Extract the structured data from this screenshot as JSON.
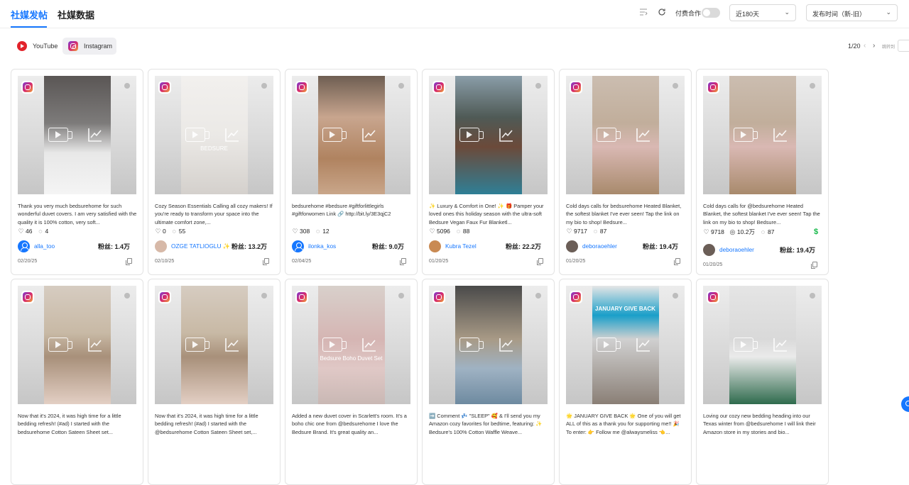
{
  "header": {
    "tabs": [
      {
        "label": "社媒发帖",
        "active": true
      },
      {
        "label": "社媒数据",
        "active": false
      }
    ],
    "paid_label": "付费合作",
    "paid_toggle_on": false,
    "period_select": "近180天",
    "sort_select": "发布时间（新-旧）"
  },
  "platforms": [
    {
      "label": "YouTube",
      "icon": "youtube-icon",
      "active": false
    },
    {
      "label": "Instagram",
      "icon": "instagram-icon",
      "active": true
    }
  ],
  "pagination": {
    "indicator": "1/20",
    "jump_label": "跳转到"
  },
  "accent_color": "#1677ff",
  "cards": [
    {
      "caption": "Thank you very much bedsurehome for such wonderful duvet covers. I am very satisfied with the quality it is 100% cotton, very soft...",
      "likes": "46",
      "comments": "4",
      "author": "alla_too",
      "avatar": "default",
      "fans": "粉丝: 1.4万",
      "date": "02/20/25"
    },
    {
      "caption": "Cozy Season Essentials Calling all cozy makers! If you're ready to transform your space into the ultimate comfort zone,...",
      "likes": "0",
      "comments": "55",
      "author": "OZGE TATLIOGLU ✨",
      "avatar": "photo",
      "fans": "粉丝: 13.2万",
      "date": "02/10/25",
      "overlay": "BEDSURE"
    },
    {
      "caption": "bedsurehome #bedsure #giftforlittlegirls #giftforwomen Link 🔗 http://bit.ly/3E3qjC2",
      "likes": "308",
      "comments": "12",
      "author": "ilonka_kos",
      "avatar": "default",
      "fans": "粉丝: 9.0万",
      "date": "02/04/25"
    },
    {
      "caption": "✨ Luxury & Comfort in One! ✨ 🎁 Pamper your loved ones this holiday season with the ultra-soft Bedsure Vegan Faux Fur Blanketl...",
      "likes": "5096",
      "comments": "88",
      "author": "Kubra Tezel",
      "avatar": "photo",
      "fans": "粉丝: 22.2万",
      "date": "01/20/25"
    },
    {
      "caption": "Cold days calls for bedsurehome Heated Blanket, the softest blanket I've ever seen! Tap the link on my bio to shop! Bedsure...",
      "likes": "9717",
      "comments": "87",
      "author": "deboraoehler",
      "avatar": "photo",
      "fans": "粉丝: 19.4万",
      "date": "01/20/25"
    },
    {
      "caption": "Cold days calls for @bedsurehome Heated Blanket, the softest blanket I've ever seen! Tap the link on my bio to shop! Bedsure...",
      "likes": "9718",
      "views": "10.2万",
      "comments": "87",
      "author": "deboraoehler",
      "avatar": "photo",
      "fans": "粉丝: 19.4万",
      "date": "01/20/25",
      "paid": true
    },
    {
      "caption": "Now that it's 2024, it was high time for a little bedding refresh! (#ad) I started with the bedsurehome Cotton Sateen Sheet set...",
      "likes": "",
      "comments": "",
      "author": "",
      "fans": "",
      "date": ""
    },
    {
      "caption": "Now that it's 2024, it was high time for a little bedding refresh! (#ad) I started with the @bedsurehome Cotton Sateen Sheet set,...",
      "likes": "",
      "comments": "",
      "author": "",
      "fans": "",
      "date": ""
    },
    {
      "caption": "Added a new duvet cover in Scarlett's room. It's a boho chic one from @bedsurehome I love the Bedsure Brand. It's great quality an...",
      "likes": "",
      "comments": "",
      "author": "",
      "fans": "",
      "date": "",
      "overlay": "Bedsure Boho Duvet Set"
    },
    {
      "caption": "➡️ Comment 💤 \"SLEEP\" 🥰 & I'll send you my Amazon cozy favorites for bedtime, featuring: ✨ Bedsure's 100% Cotton Waffle Weave...",
      "likes": "",
      "comments": "",
      "author": "",
      "fans": "",
      "date": ""
    },
    {
      "caption": "🌟 JANUARY GIVE BACK 🌟 One of you will get ALL of this as a thank you for supporting me!! 🎉 To enter: 👉 Follow me @alwaysmeliss 👈...",
      "likes": "",
      "comments": "",
      "author": "",
      "fans": "",
      "date": "",
      "overlay": "JANUARY GIVE BACK"
    },
    {
      "caption": "Loving our cozy new bedding heading into our Texas winter from @bedsurehome I will link their Amazon store in my stories and bio...",
      "likes": "",
      "comments": "",
      "author": "",
      "fans": "",
      "date": ""
    }
  ]
}
